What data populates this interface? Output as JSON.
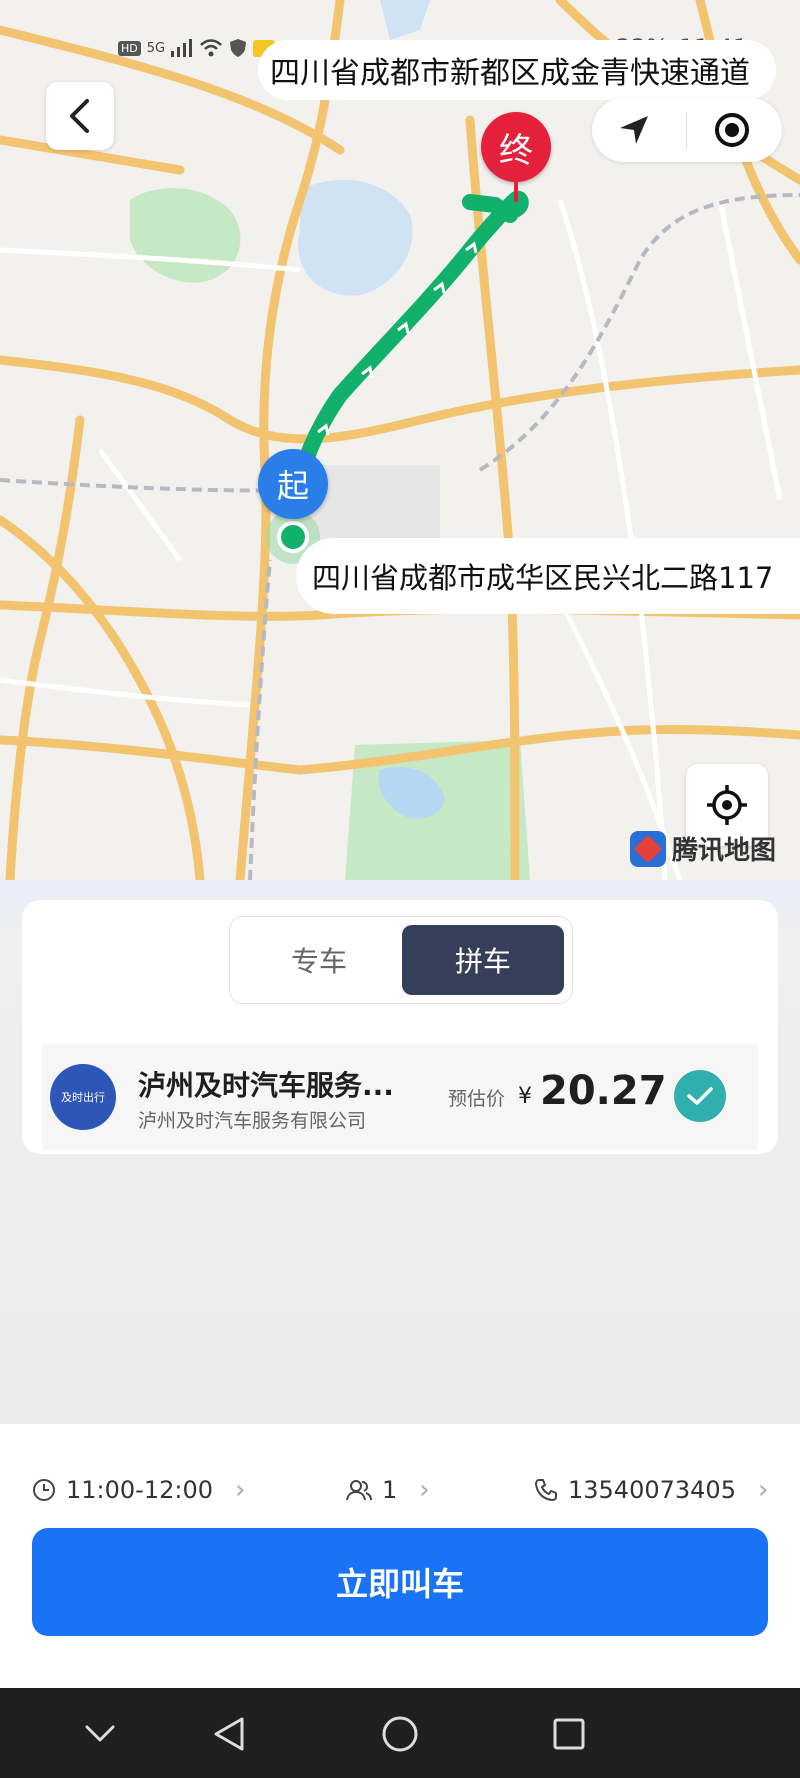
{
  "status_bar": {
    "left_icons": [
      "HD",
      "5G",
      "signal-icon",
      "wifi-icon",
      "shield-icon",
      "mail-icon"
    ],
    "battery": "33%",
    "time": "11:41"
  },
  "map": {
    "destination_address": "四川省成都市新都区成金青快速通道",
    "origin_address": "四川省成都市成华区民兴北二路117",
    "start_marker": "起",
    "end_marker": "终",
    "provider_logo_text": "腾讯地图",
    "route_color": "#11b06b"
  },
  "ride_card": {
    "tabs": [
      "专车",
      "拼车"
    ],
    "selected_tab": "拼车",
    "provider": {
      "name": "泸州及时汽车服务...",
      "company": "泸州及时汽车服务有限公司",
      "logo_text": "及时出行",
      "estimate_label": "预估价",
      "currency": "¥",
      "price": "20.27",
      "selected": true
    }
  },
  "options": {
    "time": "11:00-12:00",
    "passengers": "1",
    "phone": "13540073405"
  },
  "cta": {
    "label": "立即叫车",
    "color": "#1a73f5"
  },
  "nav_bar": {
    "buttons": [
      "chevron-down-icon",
      "back-triangle-icon",
      "home-circle-icon",
      "recents-square-icon"
    ]
  }
}
